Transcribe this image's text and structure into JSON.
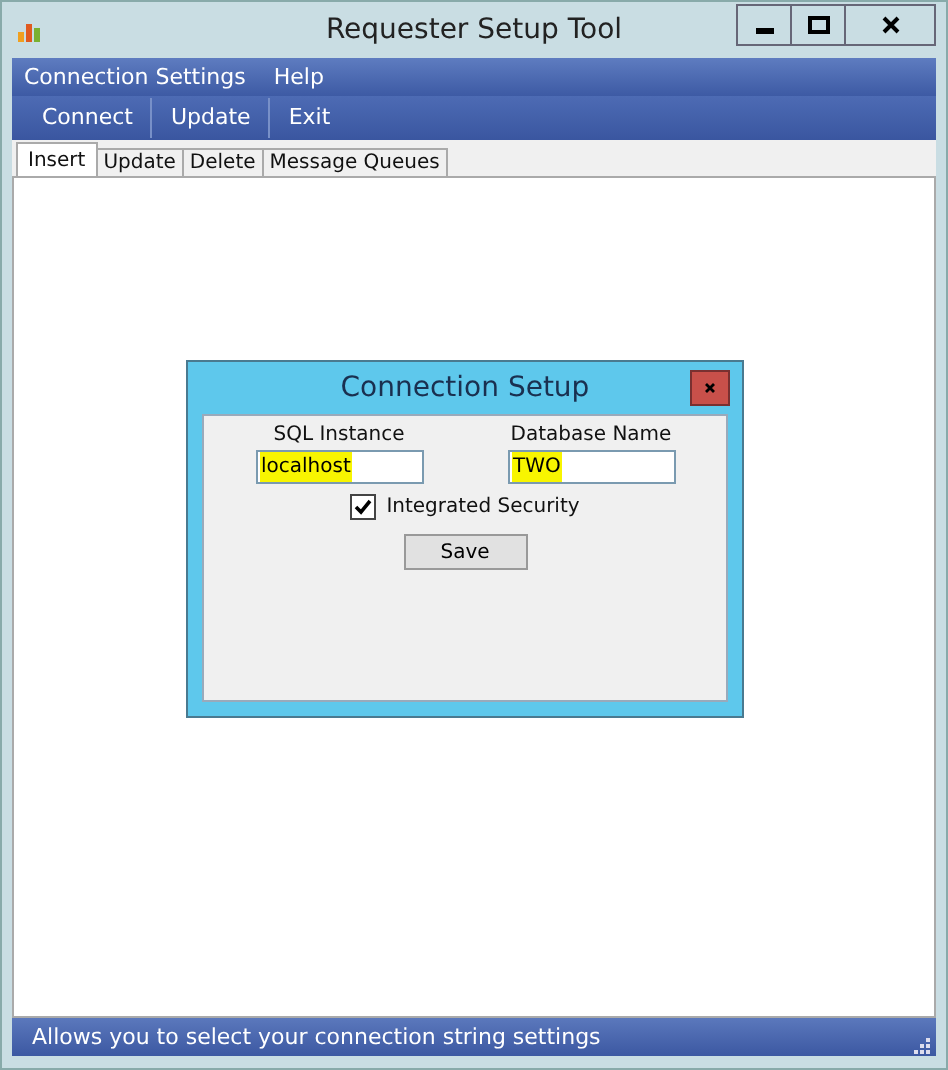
{
  "window": {
    "title": "Requester Setup Tool"
  },
  "menu": [
    "Connection Settings",
    "Help"
  ],
  "toolbar": [
    "Connect",
    "Update",
    "Exit"
  ],
  "tabs": [
    {
      "label": "Insert",
      "selected": true
    },
    {
      "label": "Update",
      "selected": false
    },
    {
      "label": "Delete",
      "selected": false
    },
    {
      "label": "Message Queues",
      "selected": false
    }
  ],
  "dialog": {
    "title": "Connection Setup",
    "fields": [
      {
        "label": "SQL Instance",
        "value": "localhost",
        "selected": true
      },
      {
        "label": "Database Name",
        "value": "TWO",
        "selected": true
      }
    ],
    "checkbox": {
      "label": "Integrated Security",
      "checked": true
    },
    "button": "Save"
  },
  "status_bar": "Allows you to select your connection string settings"
}
